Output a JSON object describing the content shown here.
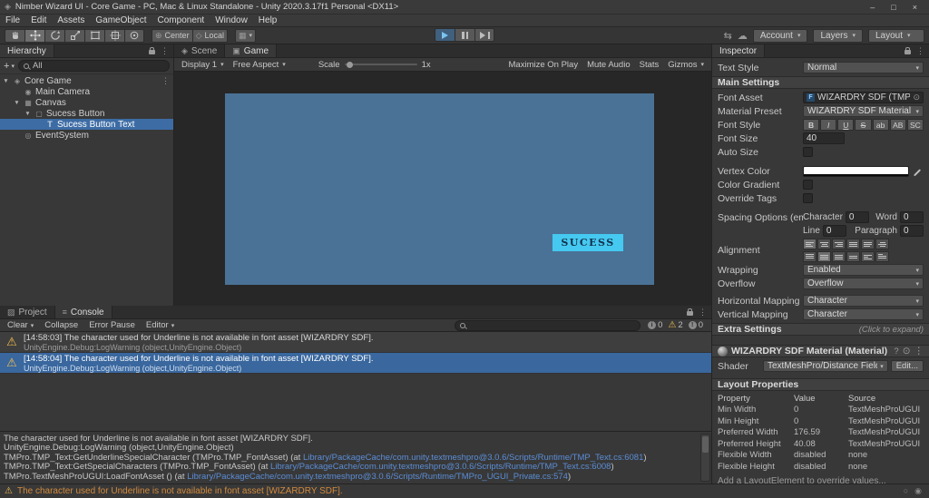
{
  "colors": {
    "selection": "#3d6ca5",
    "game_canvas": "#4a7296",
    "success_button_bg": "#45c9f0",
    "success_button_text": "#13304e",
    "warning_icon": "#f4bf4f",
    "status_warning_text": "#d28a3d",
    "console_link": "#5b8dd6"
  },
  "icons": {
    "unity_logo": "◈",
    "minimize": "–",
    "maximize": "□",
    "close": "×",
    "caret": "▾",
    "menu": "⋮",
    "plus": "+",
    "expand": "▼",
    "scene": "◈",
    "camera": "◉",
    "canvas": "▦",
    "ui_element": "▢",
    "text": "T",
    "event_system": "◎",
    "warning": "⚠",
    "cloud": "☁",
    "collab": "⇆",
    "center": "⊕",
    "local": "◇",
    "grid": "▦",
    "picker": "⊙",
    "font_asset": "F",
    "help": "?",
    "preset": "⊙",
    "project": "▨",
    "console": "≡",
    "scene_tab": "◈",
    "game_tab": "▣",
    "info": "i",
    "error": "!",
    "status_a": "◉",
    "status_b": "○"
  },
  "window": {
    "title": "Nimber Wizard UI - Core Game - PC, Mac & Linux Standalone - Unity 2020.3.17f1 Personal <DX11>"
  },
  "menubar": [
    "File",
    "Edit",
    "Assets",
    "GameObject",
    "Component",
    "Window",
    "Help"
  ],
  "toolbar": {
    "pivot": "Center",
    "space": "Local",
    "account": "Account",
    "layers": "Layers",
    "layout": "Layout"
  },
  "hierarchy": {
    "tab": "Hierarchy",
    "search": "All",
    "items": [
      {
        "label": "Core Game"
      },
      {
        "label": "Main Camera"
      },
      {
        "label": "Canvas"
      },
      {
        "label": "Sucess Button"
      },
      {
        "label": "Sucess Button Text"
      },
      {
        "label": "EventSystem"
      }
    ]
  },
  "viewport": {
    "scene_tab": "Scene",
    "game_tab": "Game",
    "display": "Display 1",
    "aspect": "Free Aspect",
    "scale_label": "Scale",
    "scale_value": "1x",
    "maximize_on_play": "Maximize On Play",
    "mute_audio": "Mute Audio",
    "stats": "Stats",
    "gizmos": "Gizmos",
    "success_label": "SUCESS"
  },
  "inspector": {
    "tab": "Inspector",
    "text_style_label": "Text Style",
    "text_style_value": "Normal",
    "main_settings_header": "Main Settings",
    "font_asset_label": "Font Asset",
    "font_asset_value": "WIZARDRY SDF (TMP_Font A",
    "material_preset_label": "Material Preset",
    "material_preset_value": "WIZARDRY SDF Material",
    "font_style_label": "Font Style",
    "font_style_buttons": [
      "B",
      "I",
      "U",
      "S",
      "ab",
      "AB",
      "SC"
    ],
    "font_size_label": "Font Size",
    "font_size_value": "40",
    "auto_size_label": "Auto Size",
    "vertex_color_label": "Vertex Color",
    "color_gradient_label": "Color Gradient",
    "override_tags_label": "Override Tags",
    "spacing_label": "Spacing Options (em)",
    "spacing": {
      "character_label": "Character",
      "character": "0",
      "word_label": "Word",
      "word": "0",
      "line_label": "Line",
      "line": "0",
      "paragraph_label": "Paragraph",
      "paragraph": "0"
    },
    "alignment_label": "Alignment",
    "wrapping_label": "Wrapping",
    "wrapping_value": "Enabled",
    "overflow_label": "Overflow",
    "overflow_value": "Overflow",
    "horizontal_mapping_label": "Horizontal Mapping",
    "horizontal_mapping_value": "Character",
    "vertical_mapping_label": "Vertical Mapping",
    "vertical_mapping_value": "Character",
    "extra_settings_header": "Extra Settings",
    "extra_settings_hint": "(Click to expand)",
    "material_header": "WIZARDRY SDF Material (Material)",
    "shader_label": "Shader",
    "shader_value": "TextMeshPro/Distance Field",
    "shader_edit": "Edit...",
    "layout_header": "Layout Properties",
    "layout_columns": [
      "Property",
      "Value",
      "Source"
    ],
    "layout_rows": [
      {
        "property": "Min Width",
        "value": "0",
        "source": "TextMeshProUGUI"
      },
      {
        "property": "Min Height",
        "value": "0",
        "source": "TextMeshProUGUI"
      },
      {
        "property": "Preferred Width",
        "value": "176.59",
        "source": "TextMeshProUGUI"
      },
      {
        "property": "Preferred Height",
        "value": "40.08",
        "source": "TextMeshProUGUI"
      },
      {
        "property": "Flexible Width",
        "value": "disabled",
        "source": "none"
      },
      {
        "property": "Flexible Height",
        "value": "disabled",
        "source": "none"
      }
    ],
    "layout_note": "Add a LayoutElement to override values..."
  },
  "console": {
    "project_tab": "Project",
    "console_tab": "Console",
    "clear": "Clear",
    "collapse": "Collapse",
    "error_pause": "Error Pause",
    "editor": "Editor",
    "counts": {
      "info": "0",
      "warning": "2",
      "error": "0"
    },
    "entries": [
      {
        "time": "[14:58:03]",
        "message": "The character used for Underline is not available in font asset [WIZARDRY SDF].",
        "trace": "UnityEngine.Debug:LogWarning (object,UnityEngine.Object)"
      },
      {
        "time": "[14:58:04]",
        "message": "The character used for Underline is not available in font asset [WIZARDRY SDF].",
        "trace": "UnityEngine.Debug:LogWarning (object,UnityEngine.Object)"
      }
    ],
    "detail": [
      {
        "pre": "The character used for Underline is not available in font asset [WIZARDRY SDF]."
      },
      {
        "pre": "UnityEngine.Debug:LogWarning (object,UnityEngine.Object)"
      },
      {
        "pre": "TMPro.TMP_Text:GetUnderlineSpecialCharacter (TMPro.TMP_FontAsset) (at ",
        "link": "Library/PackageCache/com.unity.textmeshpro@3.0.6/Scripts/Runtime/TMP_Text.cs:6081",
        "post": ")"
      },
      {
        "pre": "TMPro.TMP_Text:GetSpecialCharacters (TMPro.TMP_FontAsset) (at ",
        "link": "Library/PackageCache/com.unity.textmeshpro@3.0.6/Scripts/Runtime/TMP_Text.cs:6008",
        "post": ")"
      },
      {
        "pre": "TMPro.TextMeshProUGUI:LoadFontAsset () (at ",
        "link": "Library/PackageCache/com.unity.textmeshpro@3.0.6/Scripts/Runtime/TMPro_UGUI_Private.cs:574",
        "post": ")"
      }
    ]
  },
  "statusbar": {
    "message": "The character used for Underline is not available in font asset [WIZARDRY SDF]."
  }
}
